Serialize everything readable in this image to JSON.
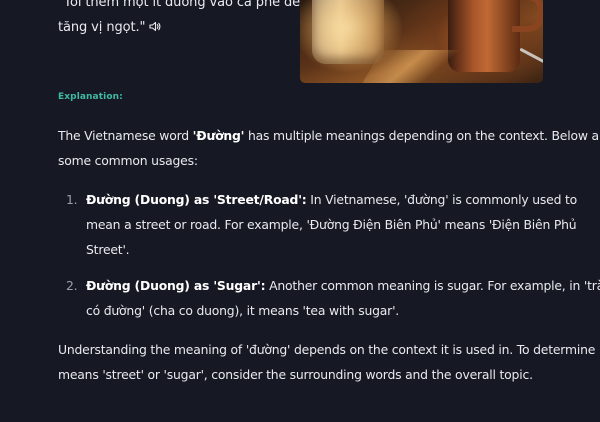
{
  "example": {
    "line1": "\"Tôi thêm một ít đường vào cà phê để",
    "line2": "tăng vị ngọt.\"",
    "speaker_icon": "speaker-icon"
  },
  "photo": {
    "description_icon": "coffee-mugs-image"
  },
  "explanation": {
    "label": "Explanation:",
    "intro_prefix": "The Vietnamese word ",
    "intro_word": "'Đường'",
    "intro_suffix": " has multiple meanings depending on the context. Below are",
    "intro_line2": "some common usages:",
    "items": [
      {
        "number": "1.",
        "title": "Đường (Duong) as 'Street/Road':",
        "line1_rest": " In Vietnamese, 'đường' is commonly used to",
        "line2": "mean a street or road. For example, 'Đường Điện Biên Phủ' means 'Điện Biên Phủ",
        "line3": "Street'."
      },
      {
        "number": "2.",
        "title": "Đường (Duong) as 'Sugar':",
        "line1_rest": " Another common meaning is sugar. For example, in 'trà",
        "line2": "có đường' (cha co duong), it means 'tea with sugar'."
      }
    ],
    "outro_line1": "Understanding the meaning of 'đường' depends on the context it is used in. To determine if it",
    "outro_line2": "means 'street' or 'sugar', consider the surrounding words and the overall topic."
  }
}
